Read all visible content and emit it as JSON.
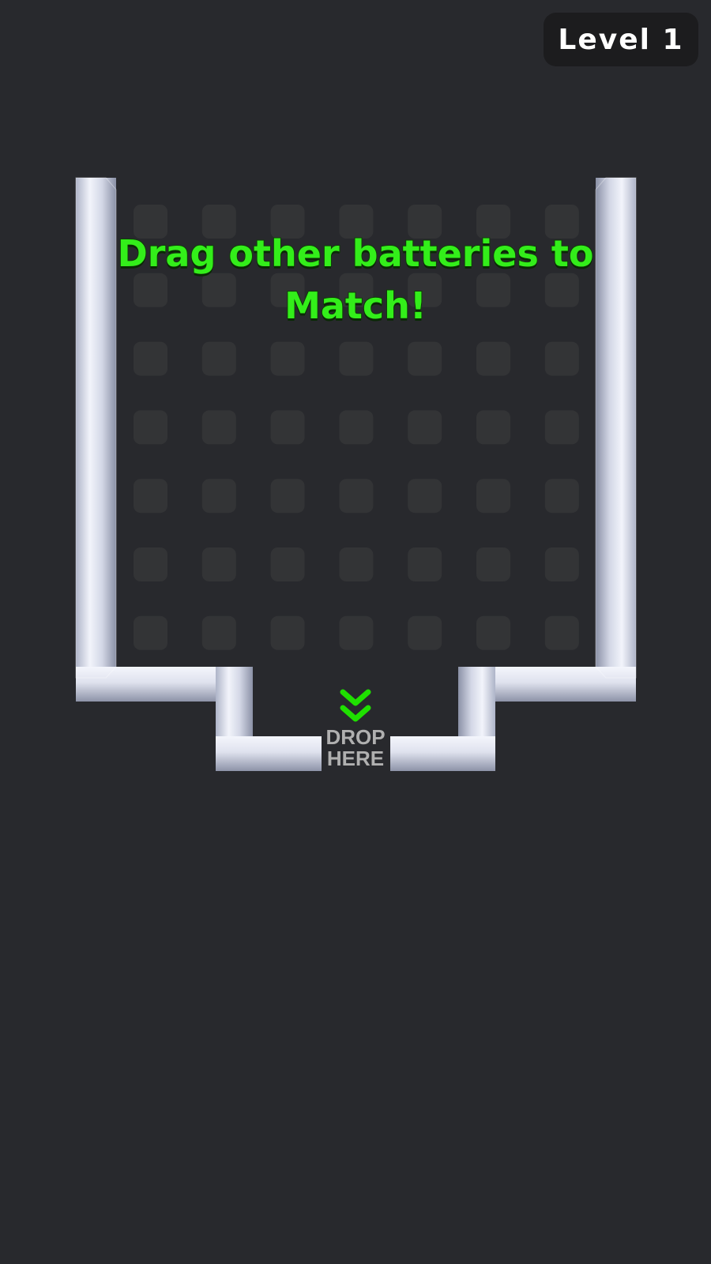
{
  "header": {
    "level_label": "Level 1"
  },
  "instruction": {
    "text": "Drag other batteries to Match!"
  },
  "drop_zone": {
    "label_line1": "DROP",
    "label_line2": "HERE",
    "arrow_icon": "double-chevron-down-icon"
  },
  "board": {
    "rows": 7,
    "cols": 7
  },
  "colors": {
    "background": "#28292d",
    "slot": "#333436",
    "accent_green": "#33ee1a",
    "container_metal": "#d6d9e6"
  }
}
